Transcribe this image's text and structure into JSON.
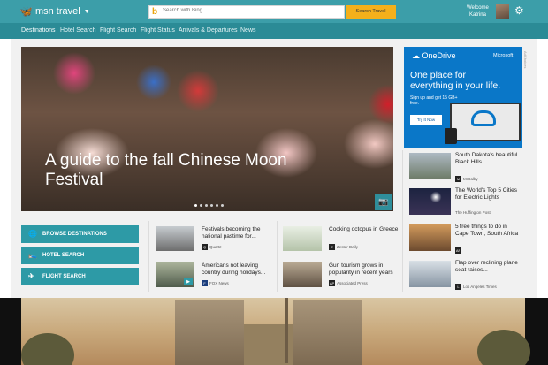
{
  "header": {
    "logo": "msn travel",
    "search_placeholder": "Search with Bing",
    "search_button": "Search Travel",
    "welcome_line1": "Welcome",
    "welcome_name": "Katrina"
  },
  "nav": [
    "Destinations",
    "Hotel Search",
    "Flight Search",
    "Flight Status",
    "Arrivals & Departures",
    "News"
  ],
  "hero": {
    "title": "A guide to the fall Chinese Moon Festival",
    "carousel_total": 6,
    "carousel_current": 1
  },
  "ad": {
    "product": "OneDrive",
    "brand": "Microsoft",
    "headline": "One place for everything in your life.",
    "sub": "Sign up and get 15 GB+ free.",
    "cta": "Try It Now",
    "adchoices": "AdChoices"
  },
  "side_stories": [
    {
      "title": "South Dakota's beautiful Black Hills",
      "source": "MrDalby",
      "thumb_color": "#7e8f9a"
    },
    {
      "title": "The World's Top 5 Cities for Electric Lights",
      "source": "The Huffington Post",
      "thumb_color": "#1f2a44"
    },
    {
      "title": "5 free things to do in Cape Town, South Africa",
      "source": "AP",
      "thumb_color": "#a26b43"
    },
    {
      "title": "Flap over reclining plane seat raises...",
      "source": "Los Angeles Times",
      "thumb_color": "#b9c5cf"
    }
  ],
  "quick_buttons": [
    {
      "label": "BROWSE DESTINATIONS",
      "icon": "globe-icon"
    },
    {
      "label": "HOTEL SEARCH",
      "icon": "bed-icon"
    },
    {
      "label": "FLIGHT SEARCH",
      "icon": "plane-icon"
    }
  ],
  "stories": [
    {
      "title": "Festivals becoming the national pastime for...",
      "source": "Quartz",
      "source_icon": "Q",
      "thumb_color": "#8c8c8c"
    },
    {
      "title": "Cooking octopus in Greece",
      "source": "Zester Daily",
      "source_icon": "Z",
      "thumb_color": "#cfd9c2"
    },
    {
      "title": "Americans not leaving country during holidays...",
      "source": "FOX News",
      "source_icon": "F",
      "thumb_color": "#6f7f73",
      "video": true
    },
    {
      "title": "Gun tourism grows in popularity in recent years",
      "source": "Associated Press",
      "source_icon": "AP",
      "thumb_color": "#8e7f6e"
    }
  ]
}
